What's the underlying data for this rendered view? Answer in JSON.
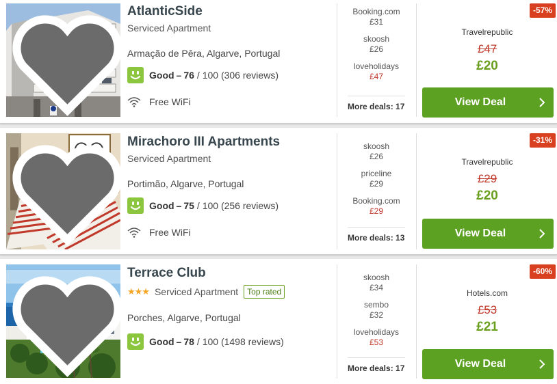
{
  "hotels": [
    {
      "name": "AtlanticSide",
      "type": "Serviced Apartment",
      "stars": "",
      "top_rated": "",
      "location": "Armação de Pêra, Algarve, Portugal",
      "rating_word": "Good",
      "rating_dash": "–",
      "rating_score": "76",
      "rating_rest": "/ 100 (306 reviews)",
      "amenity": "Free WiFi",
      "deals": [
        {
          "provider": "Booking.com",
          "price": "£31",
          "red": false
        },
        {
          "provider": "skoosh",
          "price": "£26",
          "red": false
        },
        {
          "provider": "loveholidays",
          "price": "£47",
          "red": true
        }
      ],
      "more_deals": "More deals: 17",
      "discount": "-57%",
      "best_provider": "Travelrepublic",
      "old_price": "£47",
      "price": "£20",
      "cta": "View Deal"
    },
    {
      "name": "Mirachoro III Apartments",
      "type": "Serviced Apartment",
      "stars": "",
      "top_rated": "",
      "location": "Portimão, Algarve, Portugal",
      "rating_word": "Good",
      "rating_dash": "–",
      "rating_score": "75",
      "rating_rest": "/ 100 (256 reviews)",
      "amenity": "Free WiFi",
      "deals": [
        {
          "provider": "skoosh",
          "price": "£26",
          "red": false
        },
        {
          "provider": "priceline",
          "price": "£29",
          "red": false
        },
        {
          "provider": "Booking.com",
          "price": "£29",
          "red": true
        }
      ],
      "more_deals": "More deals: 13",
      "discount": "-31%",
      "best_provider": "Travelrepublic",
      "old_price": "£29",
      "price": "£20",
      "cta": "View Deal"
    },
    {
      "name": "Terrace Club",
      "type": "Serviced Apartment",
      "stars": "★★★",
      "top_rated": "Top rated",
      "location": "Porches, Algarve, Portugal",
      "rating_word": "Good",
      "rating_dash": "–",
      "rating_score": "78",
      "rating_rest": "/ 100 (1498 reviews)",
      "amenity": "",
      "deals": [
        {
          "provider": "skoosh",
          "price": "£34",
          "red": false
        },
        {
          "provider": "sembo",
          "price": "£32",
          "red": false
        },
        {
          "provider": "loveholidays",
          "price": "£53",
          "red": true
        }
      ],
      "more_deals": "More deals: 17",
      "discount": "-60%",
      "best_provider": "Hotels.com",
      "old_price": "£53",
      "price": "£21",
      "cta": "View Deal"
    }
  ],
  "colors": {
    "accent_green": "#5da122",
    "price_green": "#6a9e1f",
    "discount_red": "#d9401f",
    "old_price_red": "#c0392b",
    "rating_green": "#8cc63f"
  },
  "icons": {
    "favorite": "heart-icon",
    "rating": "smiley-rating-icon",
    "wifi": "wifi-icon",
    "cta": "chevron-right-icon"
  }
}
